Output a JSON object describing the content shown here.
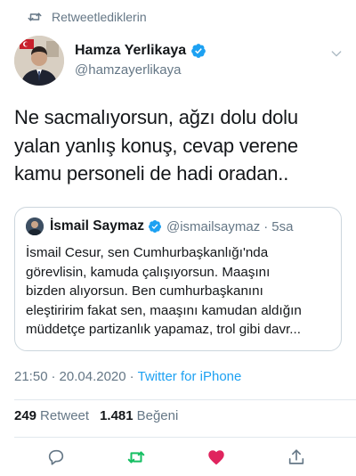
{
  "retweet_banner": {
    "label": "Retweetlediklerin",
    "icon": "retweet-icon"
  },
  "author": {
    "name": "Hamza Yerlikaya",
    "handle": "@hamzayerlikaya",
    "verified": true
  },
  "tweet": {
    "lines": [
      "Ne sacmalıyorsun, ağzı dolu dolu",
      "yalan yanlış konuş, cevap verene",
      "kamu personeli de hadi oradan.."
    ]
  },
  "quoted": {
    "name": "İsmail Saymaz",
    "handle": "@ismailsaymaz",
    "separator": "·",
    "time": "5sa",
    "lines": [
      "İsmail Cesur, sen Cumhurbaşkanlığı'nda",
      "görevlisin, kamuda çalışıyorsun. Maaşını",
      "bizden alıyorsun. Ben cumhurbaşkanını",
      "eleştiririm fakat sen, maaşını kamudan aldığın",
      "müddetçe partizanlık yapamaz, trol gibi davr..."
    ]
  },
  "meta": {
    "time": "21:50",
    "separator": "·",
    "date": "20.04.2020",
    "client": "Twitter for iPhone"
  },
  "stats": {
    "retweets": "249",
    "retweets_label": "Retweet",
    "likes": "1.481",
    "likes_label": "Beğeni"
  },
  "colors": {
    "accent": "#1da1f2",
    "retweet_active": "#17bf63",
    "like_active": "#e0245e",
    "secondary_text": "#657786"
  }
}
